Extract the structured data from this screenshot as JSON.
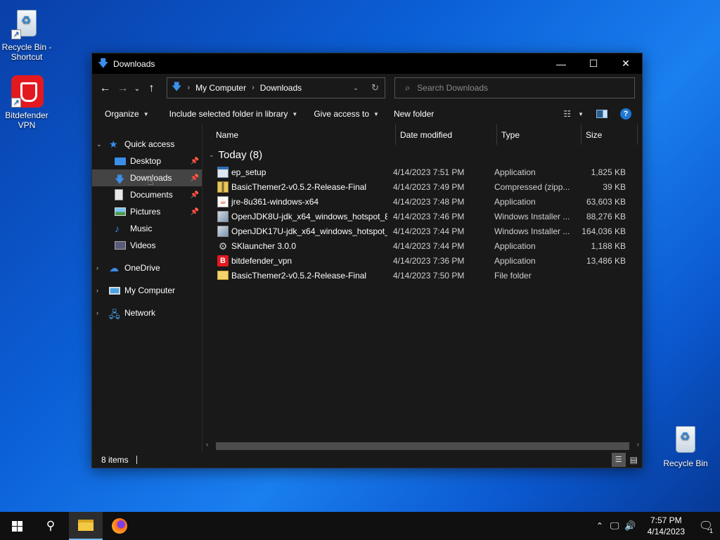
{
  "desktop": {
    "icons": [
      {
        "label": "Recycle Bin - Shortcut"
      },
      {
        "label": "Bitdefender VPN"
      },
      {
        "label": "Recycle Bin"
      }
    ]
  },
  "window": {
    "title": "Downloads",
    "controls": {
      "minimize": "—",
      "maximize": "☐",
      "close": "✕"
    }
  },
  "address": {
    "segments": [
      "My Computer",
      "Downloads"
    ],
    "search_placeholder": "Search Downloads"
  },
  "commandbar": {
    "organize": "Organize",
    "include": "Include selected folder in library",
    "give_access": "Give access to",
    "new_folder": "New folder"
  },
  "navpane": {
    "quick_access": "Quick access",
    "items": [
      {
        "label": "Desktop",
        "pinned": true
      },
      {
        "label": "Downloads",
        "pinned": true,
        "selected": true
      },
      {
        "label": "Documents",
        "pinned": true
      },
      {
        "label": "Pictures",
        "pinned": true
      },
      {
        "label": "Music",
        "pinned": false
      },
      {
        "label": "Videos",
        "pinned": false
      }
    ],
    "onedrive": "OneDrive",
    "my_computer": "My Computer",
    "network": "Network"
  },
  "columns": {
    "name": "Name",
    "date": "Date modified",
    "type": "Type",
    "size": "Size"
  },
  "group": {
    "label": "Today (8)"
  },
  "files": [
    {
      "name": "ep_setup",
      "date": "4/14/2023 7:51 PM",
      "type": "Application",
      "size": "1,825 KB",
      "icon": "app-icon"
    },
    {
      "name": "BasicThemer2-v0.5.2-Release-Final",
      "date": "4/14/2023 7:49 PM",
      "type": "Compressed (zipp...",
      "size": "39 KB",
      "icon": "zip-icon"
    },
    {
      "name": "jre-8u361-windows-x64",
      "date": "4/14/2023 7:48 PM",
      "type": "Application",
      "size": "63,603 KB",
      "icon": "java-icon"
    },
    {
      "name": "OpenJDK8U-jdk_x64_windows_hotspot_8...",
      "date": "4/14/2023 7:46 PM",
      "type": "Windows Installer ...",
      "size": "88,276 KB",
      "icon": "msi-icon"
    },
    {
      "name": "OpenJDK17U-jdk_x64_windows_hotspot_...",
      "date": "4/14/2023 7:44 PM",
      "type": "Windows Installer ...",
      "size": "164,036 KB",
      "icon": "msi-icon"
    },
    {
      "name": "SKlauncher 3.0.0",
      "date": "4/14/2023 7:44 PM",
      "type": "Application",
      "size": "1,188 KB",
      "icon": "gear-icon"
    },
    {
      "name": "bitdefender_vpn",
      "date": "4/14/2023 7:36 PM",
      "type": "Application",
      "size": "13,486 KB",
      "icon": "bitdefender-icon"
    },
    {
      "name": "BasicThemer2-v0.5.2-Release-Final",
      "date": "4/14/2023 7:50 PM",
      "type": "File folder",
      "size": "",
      "icon": "folder-icon"
    }
  ],
  "status": {
    "items": "8 items"
  },
  "taskbar": {
    "time": "7:57 PM",
    "date": "4/14/2023",
    "notifications": "1"
  }
}
